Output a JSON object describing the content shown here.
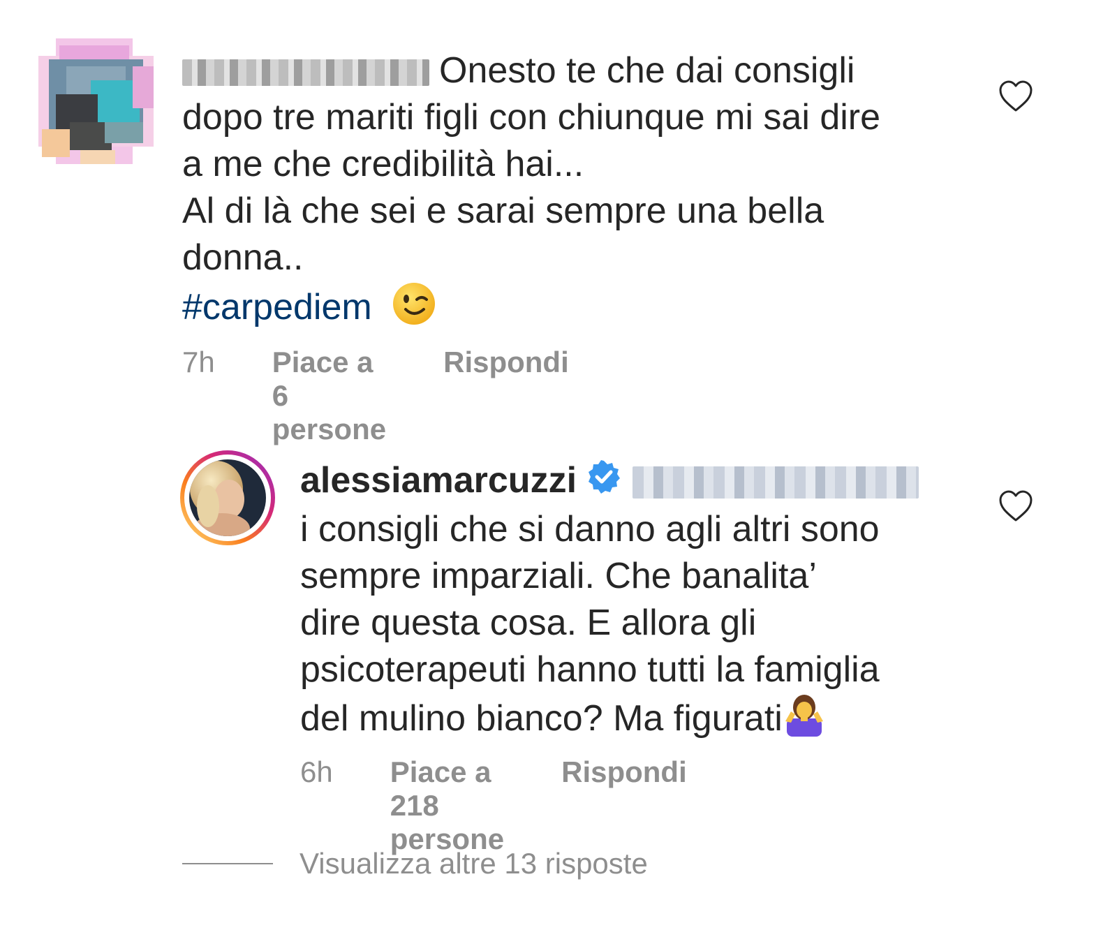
{
  "comment1": {
    "text_line1": "Onesto te che dai consigli",
    "text_line2": "dopo tre mariti figli con chiunque mi sai dire",
    "text_line3": "a me che credibilità hai...",
    "text_line4": "Al di là che sei e sarai sempre una bella",
    "text_line5": "donna..",
    "hashtag": "#carpediem",
    "emoji": "winking-face",
    "time": "7h",
    "likes": "Piace a 6 persone",
    "reply": "Rispondi"
  },
  "comment2": {
    "username": "alessiamarcuzzi",
    "text_line1": "i consigli che si danno agli altri sono",
    "text_line2": "sempre imparziali. Che banalita’",
    "text_line3": "dire questa cosa. E allora gli",
    "text_line4": "psicoterapeuti hanno tutti la famiglia",
    "text_line5": "del mulino bianco? Ma figurati",
    "emoji": "person-shrugging",
    "time": "6h",
    "likes": "Piace a 218 persone",
    "reply": "Rispondi"
  },
  "view_more": "Visualizza altre 13 risposte",
  "colors": {
    "text": "#262626",
    "secondary": "#8e8e8e",
    "hashtag": "#00376b",
    "verified": "#3897f0"
  }
}
